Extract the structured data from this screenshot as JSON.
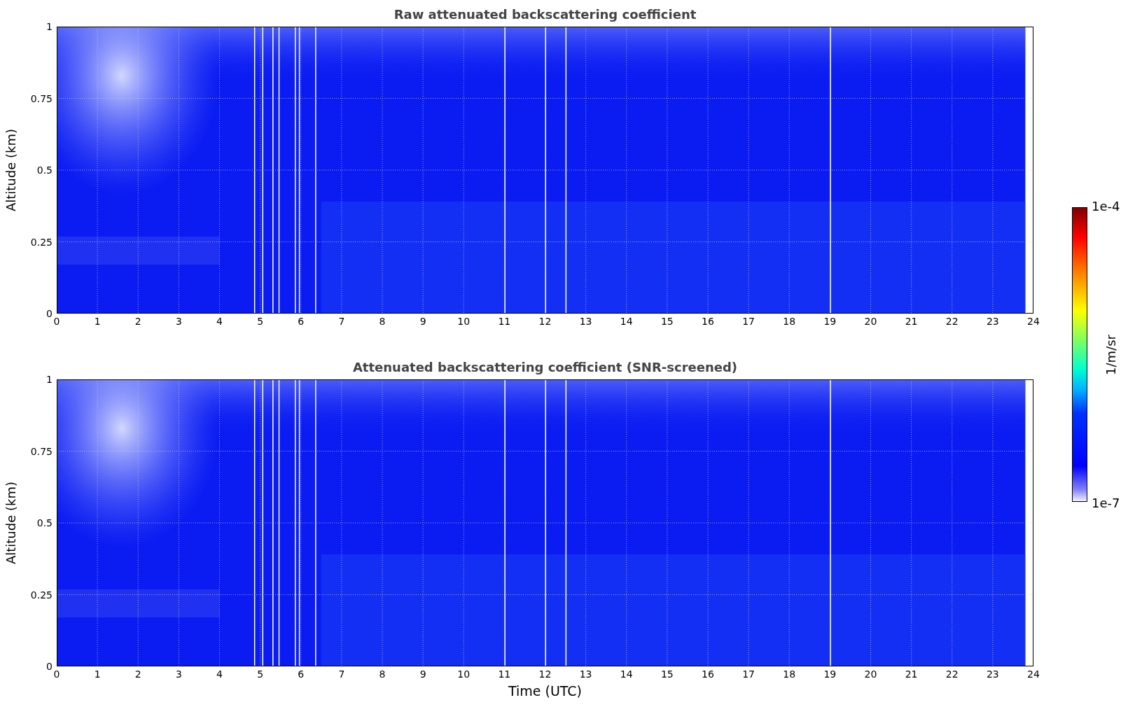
{
  "plots": [
    {
      "title": "Raw attenuated backscattering coefficient",
      "ylabel": "Altitude (km)",
      "yticks": [
        "1",
        "0.75",
        "0.5",
        "0.25",
        "0"
      ],
      "xticks": [
        "0",
        "1",
        "2",
        "3",
        "4",
        "5",
        "6",
        "7",
        "8",
        "9",
        "10",
        "11",
        "12",
        "13",
        "14",
        "15",
        "16",
        "17",
        "18",
        "19",
        "20",
        "21",
        "22",
        "23",
        "24"
      ]
    },
    {
      "title": "Attenuated backscattering coefficient (SNR-screened)",
      "ylabel": "Altitude (km)",
      "yticks": [
        "1",
        "0.75",
        "0.5",
        "0.25",
        "0"
      ],
      "xticks": [
        "0",
        "1",
        "2",
        "3",
        "4",
        "5",
        "6",
        "7",
        "8",
        "9",
        "10",
        "11",
        "12",
        "13",
        "14",
        "15",
        "16",
        "17",
        "18",
        "19",
        "20",
        "21",
        "22",
        "23",
        "24"
      ],
      "xlabel": "Time (UTC)"
    }
  ],
  "colorbar": {
    "max_label": "1e-4",
    "min_label": "1e-7",
    "unit": "1/m/sr"
  }
}
